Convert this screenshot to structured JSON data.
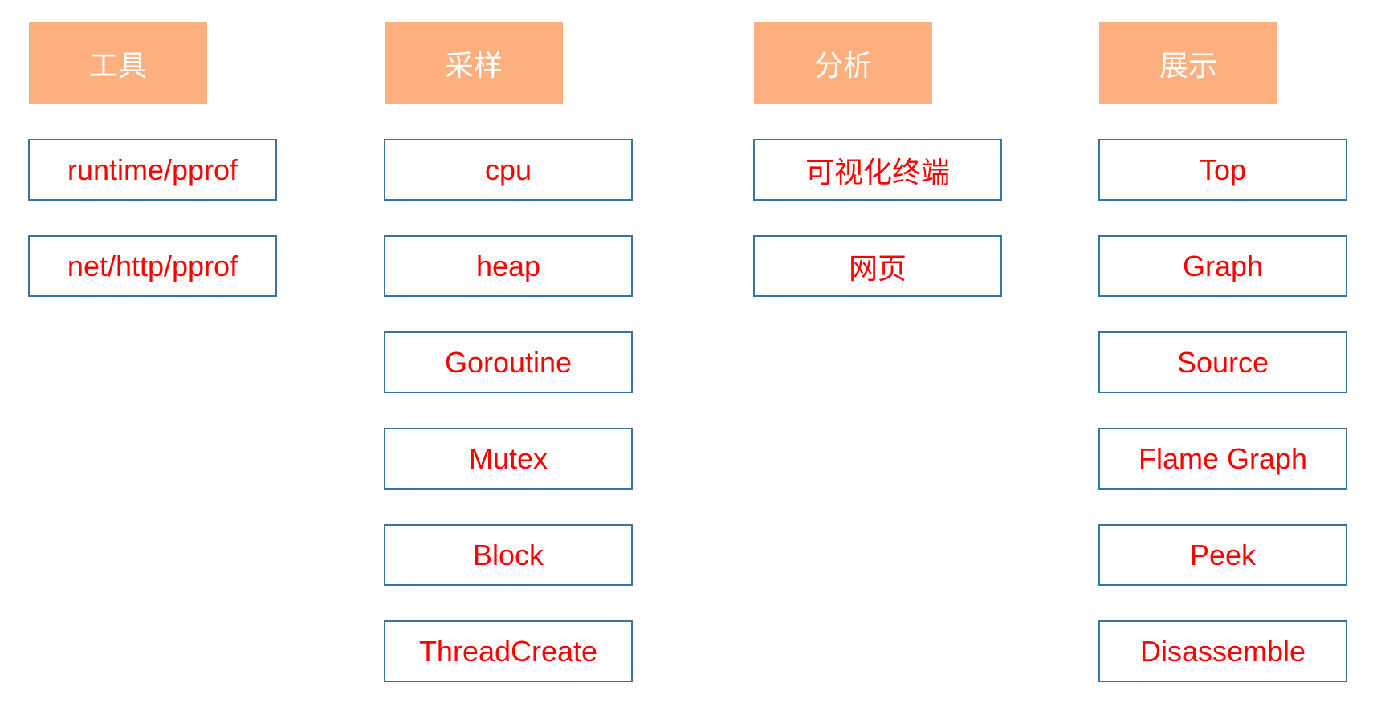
{
  "colors": {
    "header_bg": "#FDB07E",
    "header_text": "#FFFFFF",
    "box_border": "#3A74A0",
    "box_text": "#FF0000"
  },
  "columns": [
    {
      "title": "工具",
      "items": [
        "runtime/pprof",
        "net/http/pprof"
      ]
    },
    {
      "title": "采样",
      "items": [
        "cpu",
        "heap",
        "Goroutine",
        "Mutex",
        "Block",
        "ThreadCreate"
      ]
    },
    {
      "title": "分析",
      "items": [
        "可视化终端",
        "网页"
      ]
    },
    {
      "title": "展示",
      "items": [
        "Top",
        "Graph",
        "Source",
        "Flame Graph",
        "Peek",
        "Disassemble"
      ]
    }
  ]
}
